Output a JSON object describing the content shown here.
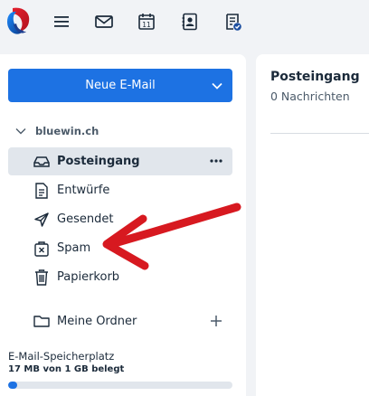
{
  "toolbar": {
    "logo": "swisscom-logo",
    "icons": [
      "menu-icon",
      "mail-icon",
      "calendar-icon",
      "contacts-icon",
      "tasks-icon"
    ],
    "calendar_day": "11"
  },
  "sidebar": {
    "new_mail_label": "Neue E-Mail",
    "account_name": "bluewin.ch",
    "folders": [
      {
        "label": "Posteingang",
        "icon": "inbox-icon",
        "active": true
      },
      {
        "label": "Entwürfe",
        "icon": "draft-icon",
        "active": false
      },
      {
        "label": "Gesendet",
        "icon": "send-icon",
        "active": false
      },
      {
        "label": "Spam",
        "icon": "spam-icon",
        "active": false
      },
      {
        "label": "Papierkorb",
        "icon": "trash-icon",
        "active": false
      }
    ],
    "my_folders_label": "Meine Ordner",
    "storage": {
      "label": "E-Mail-Speicherplatz",
      "value": "17 MB von 1 GB belegt",
      "used_fraction": 0.017
    }
  },
  "main": {
    "title": "Posteingang",
    "subtitle": "0 Nachrichten"
  },
  "colors": {
    "accent": "#1d72e3",
    "annotation": "#d71920",
    "background": "#f1f3f6",
    "active_row": "#e1e6ec"
  }
}
